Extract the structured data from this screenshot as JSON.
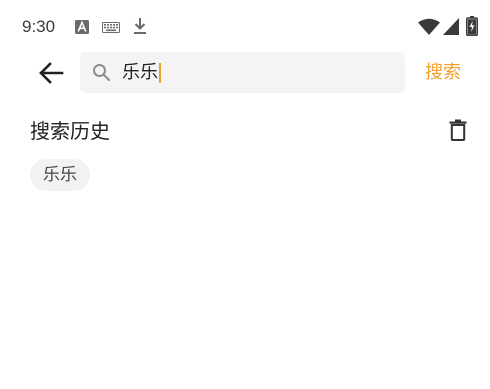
{
  "status_bar": {
    "time": "9:30",
    "notification_icons": [
      "a-notification-icon",
      "keyboard-icon",
      "download-icon"
    ],
    "system_icons": [
      "wifi-icon",
      "signal-icon",
      "battery-charging-icon"
    ]
  },
  "search": {
    "query": "乐乐",
    "submit_label": "搜索",
    "accent_color": "#f0a032"
  },
  "history": {
    "title": "搜索历史",
    "items": [
      {
        "label": "乐乐"
      }
    ]
  }
}
